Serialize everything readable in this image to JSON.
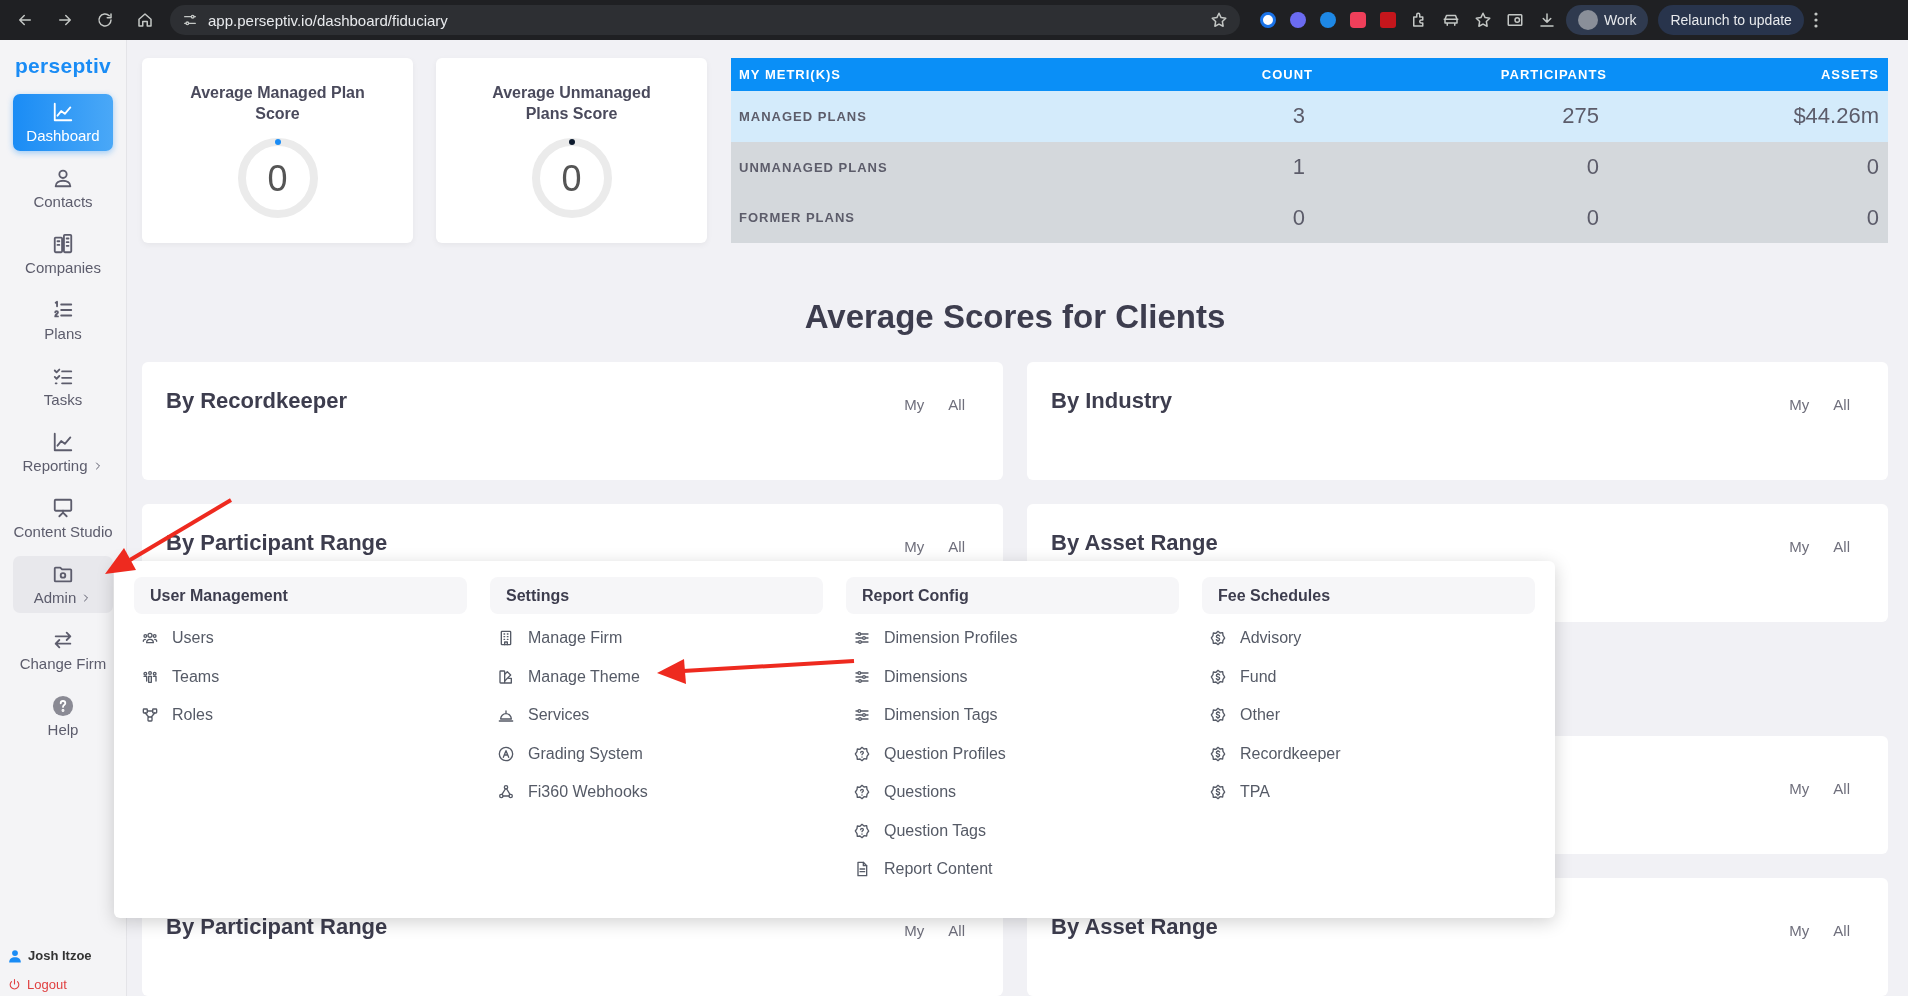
{
  "browser": {
    "url": "app.perseptiv.io/dashboard/fiduciary",
    "profile": "Work",
    "update_button": "Relaunch to update"
  },
  "sidebar": {
    "logo": "perseptiv",
    "items": [
      {
        "label": "Dashboard",
        "selected": true,
        "expanded": false,
        "submenu": false
      },
      {
        "label": "Contacts",
        "selected": false,
        "expanded": false,
        "submenu": false
      },
      {
        "label": "Companies",
        "selected": false,
        "expanded": false,
        "submenu": false
      },
      {
        "label": "Plans",
        "selected": false,
        "expanded": false,
        "submenu": false
      },
      {
        "label": "Tasks",
        "selected": false,
        "expanded": false,
        "submenu": false
      },
      {
        "label": "Reporting",
        "selected": false,
        "expanded": false,
        "submenu": true
      },
      {
        "label": "Content Studio",
        "selected": false,
        "expanded": false,
        "submenu": false
      },
      {
        "label": "Admin",
        "selected": false,
        "expanded": true,
        "submenu": true
      },
      {
        "label": "Change Firm",
        "selected": false,
        "expanded": false,
        "submenu": false
      },
      {
        "label": "Help",
        "selected": false,
        "expanded": false,
        "submenu": false
      }
    ],
    "user": "Josh Itzoe",
    "logout": "Logout"
  },
  "score_cards": [
    {
      "title": "Average Managed Plan Score",
      "value": "0",
      "level": 0,
      "color": "#1a8cf5"
    },
    {
      "title": "Average Unmanaged Plans Score",
      "value": "0",
      "level": 0,
      "color": "#0d1b2e"
    }
  ],
  "metrics_table": {
    "columns": [
      "MY METRI(K)S",
      "COUNT",
      "PARTICIPANTS",
      "ASSETS"
    ],
    "rows": [
      {
        "cells": [
          "MANAGED PLANS",
          "3",
          "275",
          "$44.26m"
        ],
        "selected": true
      },
      {
        "cells": [
          "UNMANAGED PLANS",
          "1",
          "0",
          "0"
        ],
        "selected": false
      },
      {
        "cells": [
          "FORMER PLANS",
          "0",
          "0",
          "0"
        ],
        "selected": false
      }
    ]
  },
  "sections": [
    {
      "heading": "Average Scores for Clients",
      "panels": [
        {
          "kind": "panel",
          "title": "By Recordkeeper",
          "options": [
            "My",
            "All"
          ]
        },
        {
          "kind": "panel",
          "title": "By Industry",
          "options": [
            "My",
            "All"
          ]
        },
        {
          "kind": "panel",
          "title": "By Participant Range",
          "options": [
            "My",
            "All"
          ]
        },
        {
          "kind": "panel",
          "title": "By Asset Range",
          "options": [
            "My",
            "All"
          ]
        }
      ]
    },
    {
      "panels": [
        {
          "kind": "hidden"
        },
        {
          "kind": "panel",
          "options": [
            "My",
            "All"
          ]
        },
        {
          "kind": "panel",
          "title": "By Participant Range",
          "options": [
            "My",
            "All"
          ]
        },
        {
          "kind": "panel",
          "title": "By Asset Range",
          "options": [
            "My",
            "All"
          ]
        }
      ]
    }
  ],
  "admin_menu": {
    "columns": [
      {
        "heading": "User Management",
        "items": [
          "Users",
          "Teams",
          "Roles"
        ]
      },
      {
        "heading": "Settings",
        "items": [
          "Manage Firm",
          "Manage Theme",
          "Services",
          "Grading System",
          "Fi360 Webhooks"
        ]
      },
      {
        "heading": "Report Config",
        "items": [
          "Dimension Profiles",
          "Dimensions",
          "Dimension Tags",
          "Question Profiles",
          "Questions",
          "Question Tags",
          "Report Content"
        ]
      },
      {
        "heading": "Fee Schedules",
        "items": [
          "Advisory",
          "Fund",
          "Other",
          "Recordkeeper",
          "TPA"
        ]
      }
    ]
  }
}
